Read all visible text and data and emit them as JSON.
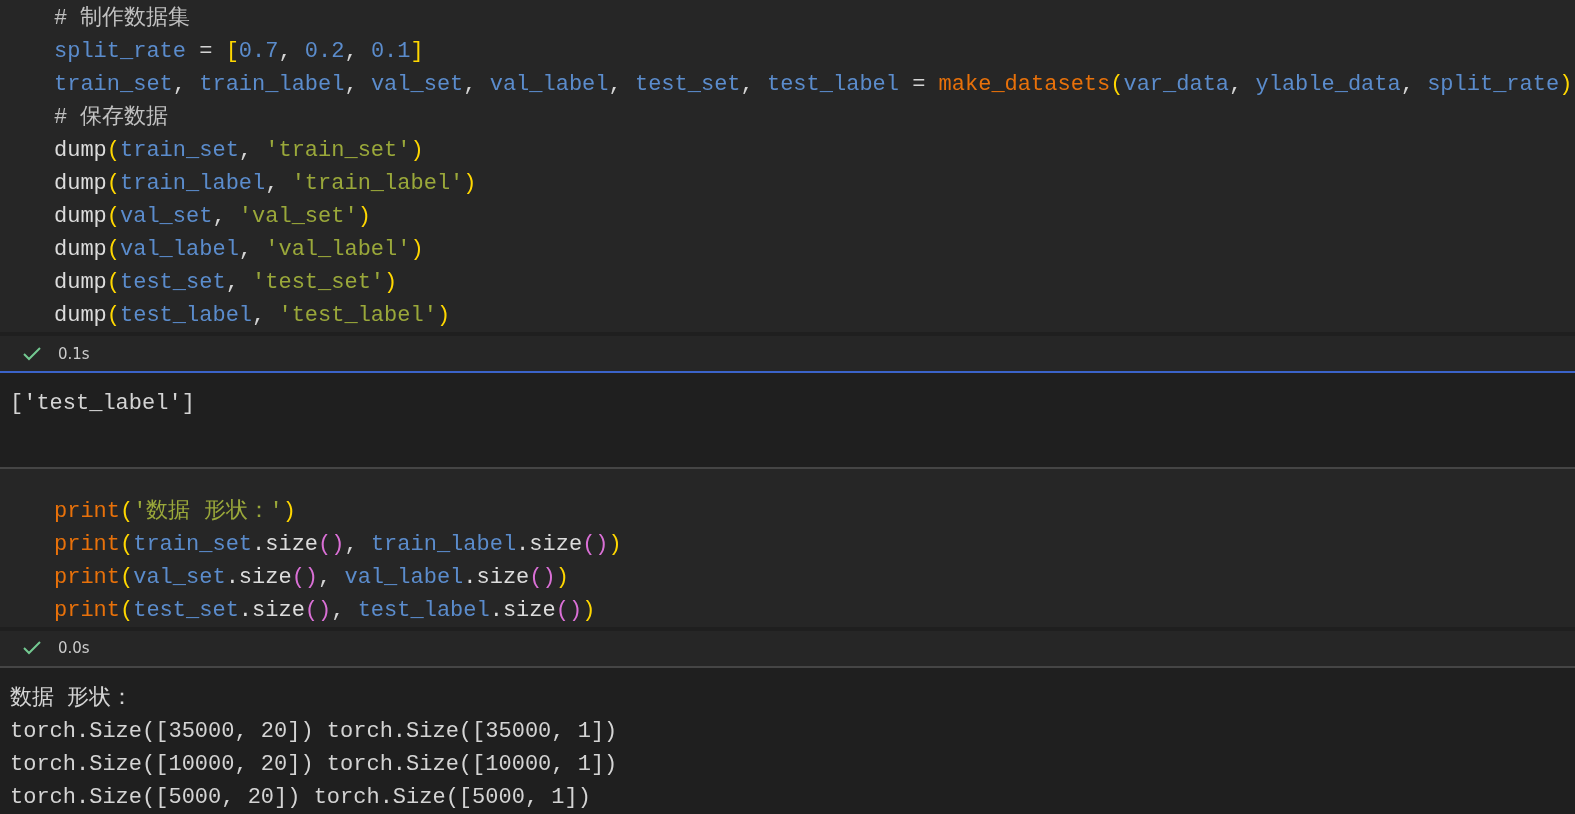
{
  "cells": [
    {
      "code": [
        [
          {
            "kind": "comment",
            "text": "# 制作数据集"
          }
        ],
        [
          {
            "kind": "var",
            "text": "split_rate"
          },
          {
            "kind": "punct",
            "text": " = "
          },
          {
            "kind": "bracket1",
            "text": "["
          },
          {
            "kind": "number",
            "text": "0.7"
          },
          {
            "kind": "punct",
            "text": ", "
          },
          {
            "kind": "number",
            "text": "0.2"
          },
          {
            "kind": "punct",
            "text": ", "
          },
          {
            "kind": "number",
            "text": "0.1"
          },
          {
            "kind": "bracket1",
            "text": "]"
          }
        ],
        [
          {
            "kind": "var",
            "text": "train_set"
          },
          {
            "kind": "punct",
            "text": ", "
          },
          {
            "kind": "var",
            "text": "train_label"
          },
          {
            "kind": "punct",
            "text": ", "
          },
          {
            "kind": "var",
            "text": "val_set"
          },
          {
            "kind": "punct",
            "text": ", "
          },
          {
            "kind": "var",
            "text": "val_label"
          },
          {
            "kind": "punct",
            "text": ", "
          },
          {
            "kind": "var",
            "text": "test_set"
          },
          {
            "kind": "punct",
            "text": ", "
          },
          {
            "kind": "var",
            "text": "test_label"
          },
          {
            "kind": "punct",
            "text": " = "
          },
          {
            "kind": "func",
            "text": "make_datasets"
          },
          {
            "kind": "bracket1",
            "text": "("
          },
          {
            "kind": "var",
            "text": "var_data"
          },
          {
            "kind": "punct",
            "text": ", "
          },
          {
            "kind": "var",
            "text": "ylable_data"
          },
          {
            "kind": "punct",
            "text": ", "
          },
          {
            "kind": "var",
            "text": "split_rate"
          },
          {
            "kind": "bracket1",
            "text": ")"
          }
        ],
        [
          {
            "kind": "comment",
            "text": "# 保存数据"
          }
        ],
        [
          {
            "kind": "call",
            "text": "dump"
          },
          {
            "kind": "bracket1",
            "text": "("
          },
          {
            "kind": "var",
            "text": "train_set"
          },
          {
            "kind": "punct",
            "text": ", "
          },
          {
            "kind": "string",
            "text": "'train_set'"
          },
          {
            "kind": "bracket1",
            "text": ")"
          }
        ],
        [
          {
            "kind": "call",
            "text": "dump"
          },
          {
            "kind": "bracket1",
            "text": "("
          },
          {
            "kind": "var",
            "text": "train_label"
          },
          {
            "kind": "punct",
            "text": ", "
          },
          {
            "kind": "string",
            "text": "'train_label'"
          },
          {
            "kind": "bracket1",
            "text": ")"
          }
        ],
        [
          {
            "kind": "call",
            "text": "dump"
          },
          {
            "kind": "bracket1",
            "text": "("
          },
          {
            "kind": "var",
            "text": "val_set"
          },
          {
            "kind": "punct",
            "text": ", "
          },
          {
            "kind": "string",
            "text": "'val_set'"
          },
          {
            "kind": "bracket1",
            "text": ")"
          }
        ],
        [
          {
            "kind": "call",
            "text": "dump"
          },
          {
            "kind": "bracket1",
            "text": "("
          },
          {
            "kind": "var",
            "text": "val_label"
          },
          {
            "kind": "punct",
            "text": ", "
          },
          {
            "kind": "string",
            "text": "'val_label'"
          },
          {
            "kind": "bracket1",
            "text": ")"
          }
        ],
        [
          {
            "kind": "call",
            "text": "dump"
          },
          {
            "kind": "bracket1",
            "text": "("
          },
          {
            "kind": "var",
            "text": "test_set"
          },
          {
            "kind": "punct",
            "text": ", "
          },
          {
            "kind": "string",
            "text": "'test_set'"
          },
          {
            "kind": "bracket1",
            "text": ")"
          }
        ],
        [
          {
            "kind": "call",
            "text": "dump"
          },
          {
            "kind": "bracket1",
            "text": "("
          },
          {
            "kind": "var",
            "text": "test_label"
          },
          {
            "kind": "punct",
            "text": ", "
          },
          {
            "kind": "string",
            "text": "'test_label'"
          },
          {
            "kind": "bracket1",
            "text": ")"
          }
        ]
      ],
      "status": {
        "succeeded": true,
        "time": "0.1s"
      },
      "selected": true,
      "output": [
        "['test_label']"
      ]
    },
    {
      "code": [
        [
          {
            "kind": "func",
            "text": "print"
          },
          {
            "kind": "bracket1",
            "text": "("
          },
          {
            "kind": "string",
            "text": "'数据 形状：'"
          },
          {
            "kind": "bracket1",
            "text": ")"
          }
        ],
        [
          {
            "kind": "func",
            "text": "print"
          },
          {
            "kind": "bracket1",
            "text": "("
          },
          {
            "kind": "var",
            "text": "train_set"
          },
          {
            "kind": "call",
            "text": ".size"
          },
          {
            "kind": "bracket2",
            "text": "()"
          },
          {
            "kind": "punct",
            "text": ", "
          },
          {
            "kind": "var",
            "text": "train_label"
          },
          {
            "kind": "call",
            "text": ".size"
          },
          {
            "kind": "bracket2",
            "text": "()"
          },
          {
            "kind": "bracket1",
            "text": ")"
          }
        ],
        [
          {
            "kind": "func",
            "text": "print"
          },
          {
            "kind": "bracket1",
            "text": "("
          },
          {
            "kind": "var",
            "text": "val_set"
          },
          {
            "kind": "call",
            "text": ".size"
          },
          {
            "kind": "bracket2",
            "text": "()"
          },
          {
            "kind": "punct",
            "text": ", "
          },
          {
            "kind": "var",
            "text": "val_label"
          },
          {
            "kind": "call",
            "text": ".size"
          },
          {
            "kind": "bracket2",
            "text": "()"
          },
          {
            "kind": "bracket1",
            "text": ")"
          }
        ],
        [
          {
            "kind": "func",
            "text": "print"
          },
          {
            "kind": "bracket1",
            "text": "("
          },
          {
            "kind": "var",
            "text": "test_set"
          },
          {
            "kind": "call",
            "text": ".size"
          },
          {
            "kind": "bracket2",
            "text": "()"
          },
          {
            "kind": "punct",
            "text": ", "
          },
          {
            "kind": "var",
            "text": "test_label"
          },
          {
            "kind": "call",
            "text": ".size"
          },
          {
            "kind": "bracket2",
            "text": "()"
          },
          {
            "kind": "bracket1",
            "text": ")"
          }
        ]
      ],
      "status": {
        "succeeded": true,
        "time": "0.0s"
      },
      "selected": false,
      "output": [
        "数据 形状：",
        "torch.Size([35000, 20]) torch.Size([35000, 1])",
        "torch.Size([10000, 20]) torch.Size([10000, 1])",
        "torch.Size([5000, 20]) torch.Size([5000, 1])"
      ]
    }
  ]
}
